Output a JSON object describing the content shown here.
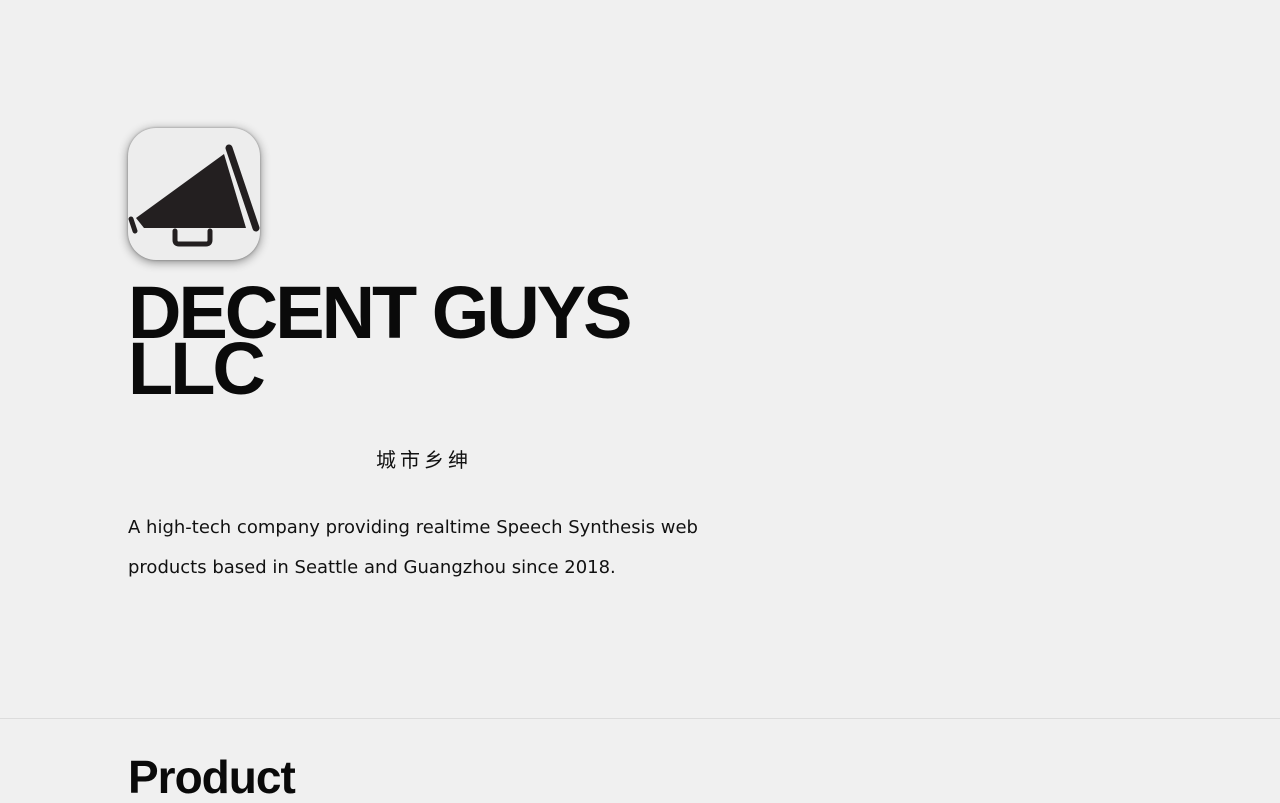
{
  "hero": {
    "logo_icon": "megaphone-icon",
    "company_name": "DECENT GUYS LLC",
    "chinese_name": "城市乡绅",
    "description": "A high-tech company providing realtime Speech Synthesis web products based in Seattle and Guangzhou since 2018."
  },
  "sections": {
    "product_title": "Product"
  },
  "colors": {
    "background": "#f0f0f0",
    "text": "#111111",
    "icon_fill": "#231f20",
    "divider": "#dcdcdc"
  }
}
